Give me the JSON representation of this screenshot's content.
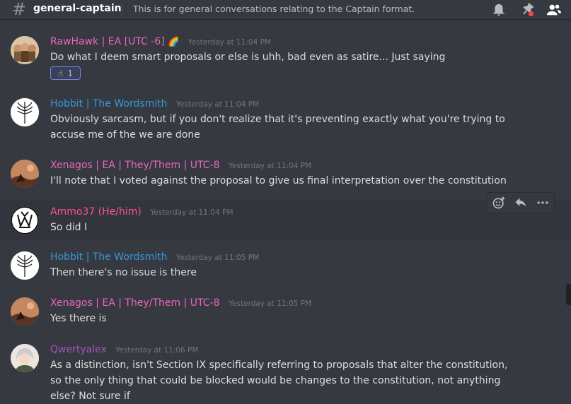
{
  "channel": {
    "hash": "#",
    "name": "general-captain",
    "topic": "This is for general conversations relating to the Captain format."
  },
  "header_icons": [
    "bell-icon",
    "pin-icon",
    "members-icon"
  ],
  "messages": [
    {
      "author": "RawHawk | EA [UTC -6]",
      "badge": "🌈",
      "timestamp": "Yesterday at 11:04 PM",
      "text": "Do what I deem smart proposals or else is uhh, bad even as satire... Just saying",
      "reaction": {
        "emoji": "☝",
        "count": "1"
      },
      "color": "#e966bf"
    },
    {
      "author": "Hobbit | The Wordsmith",
      "timestamp": "Yesterday at 11:04 PM",
      "text": "Obviously sarcasm, but if you don't realize that it's preventing exactly what you're trying to accuse me of the we are done",
      "color": "#3498db"
    },
    {
      "author": "Xenagos | EA | They/Them | UTC-8",
      "timestamp": "Yesterday at 11:04 PM",
      "text": "I'll note that I voted against the proposal to give us final interpretation over the constitution",
      "color": "#e966bf"
    },
    {
      "author": "Ammo37 (He/him)",
      "timestamp": "Yesterday at 11:04 PM",
      "text": "So did I",
      "color": "#ff4f9e"
    },
    {
      "author": "Hobbit | The Wordsmith",
      "timestamp": "Yesterday at 11:05 PM",
      "text": "Then there's no issue is there",
      "color": "#3498db"
    },
    {
      "author": "Xenagos | EA | They/Them | UTC-8",
      "timestamp": "Yesterday at 11:05 PM",
      "text": "Yes there is",
      "color": "#e966bf"
    },
    {
      "author": "Qwertyalex",
      "timestamp": "Yesterday at 11:06 PM",
      "text": "As a distinction, isn't Section IX specifically referring to proposals that alter the constitution, so the only thing that could be blocked would be changes to the constitution, not anything else? Not sure if",
      "color": "#9b59b6"
    }
  ],
  "toolbar": [
    "add-reaction-icon",
    "reply-icon",
    "more-icon"
  ]
}
